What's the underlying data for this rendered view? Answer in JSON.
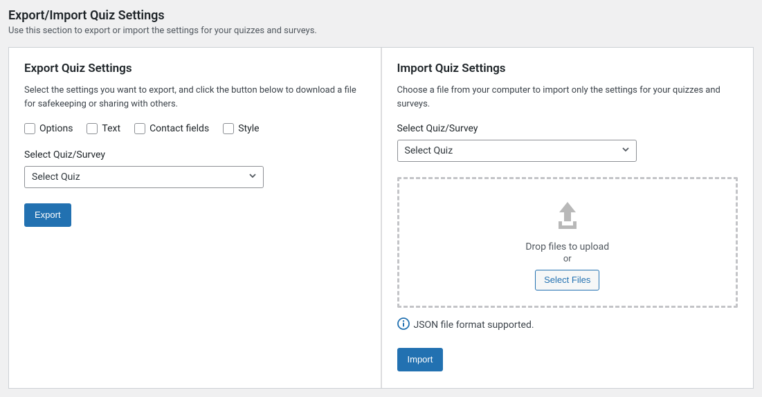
{
  "header": {
    "title": "Export/Import Quiz Settings",
    "subtitle": "Use this section to export or import the settings for your quizzes and surveys."
  },
  "export": {
    "title": "Export Quiz Settings",
    "desc": "Select the settings you want to export, and click the button below to download a file for safekeeping or sharing with others.",
    "checkboxes": {
      "options": "Options",
      "text": "Text",
      "contact_fields": "Contact fields",
      "style": "Style"
    },
    "select_label": "Select Quiz/Survey",
    "select_value": "Select Quiz",
    "button": "Export"
  },
  "import": {
    "title": "Import Quiz Settings",
    "desc": "Choose a file from your computer to import only the settings for your quizzes and surveys.",
    "select_label": "Select Quiz/Survey",
    "select_value": "Select Quiz",
    "dropzone": {
      "drop_text": "Drop files to upload",
      "or": "or",
      "select_button": "Select Files"
    },
    "info": "JSON file format supported.",
    "button": "Import"
  }
}
